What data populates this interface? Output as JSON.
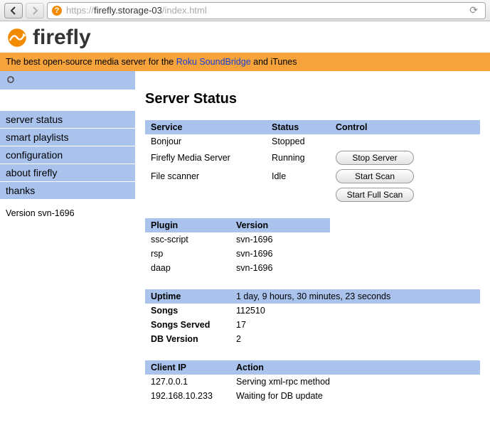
{
  "browser": {
    "url_proto": "https://",
    "url_host": "firefly.storage-03",
    "url_path": "/index.html"
  },
  "header": {
    "logo_text": "firefly",
    "tagline_pre": "The best open-source media server for the ",
    "tagline_link": "Roku SoundBridge",
    "tagline_post": " and iTunes"
  },
  "sidebar": {
    "items": [
      "server status",
      "smart playlists",
      "configuration",
      "about firefly",
      "thanks"
    ],
    "version": "Version svn-1696"
  },
  "main": {
    "title": "Server Status",
    "services": {
      "headers": [
        "Service",
        "Status",
        "Control"
      ],
      "rows": [
        {
          "service": "Bonjour",
          "status": "Stopped",
          "control": ""
        },
        {
          "service": "Firefly Media Server",
          "status": "Running",
          "control": "Stop Server"
        },
        {
          "service": "File scanner",
          "status": "Idle",
          "control": "Start Scan"
        }
      ],
      "extra_control": "Start Full Scan"
    },
    "plugins": {
      "headers": [
        "Plugin",
        "Version"
      ],
      "rows": [
        {
          "plugin": "ssc-script",
          "version": "svn-1696"
        },
        {
          "plugin": "rsp",
          "version": "svn-1696"
        },
        {
          "plugin": "daap",
          "version": "svn-1696"
        }
      ]
    },
    "stats": {
      "rows": [
        {
          "k": "Uptime",
          "v": "1 day, 9 hours, 30 minutes, 23 seconds"
        },
        {
          "k": "Songs",
          "v": "112510"
        },
        {
          "k": "Songs Served",
          "v": "17"
        },
        {
          "k": "DB Version",
          "v": "2"
        }
      ]
    },
    "clients": {
      "headers": [
        "Client IP",
        "Action"
      ],
      "rows": [
        {
          "ip": "127.0.0.1",
          "action": "Serving xml-rpc method"
        },
        {
          "ip": "192.168.10.233",
          "action": "Waiting for DB update"
        }
      ]
    }
  }
}
